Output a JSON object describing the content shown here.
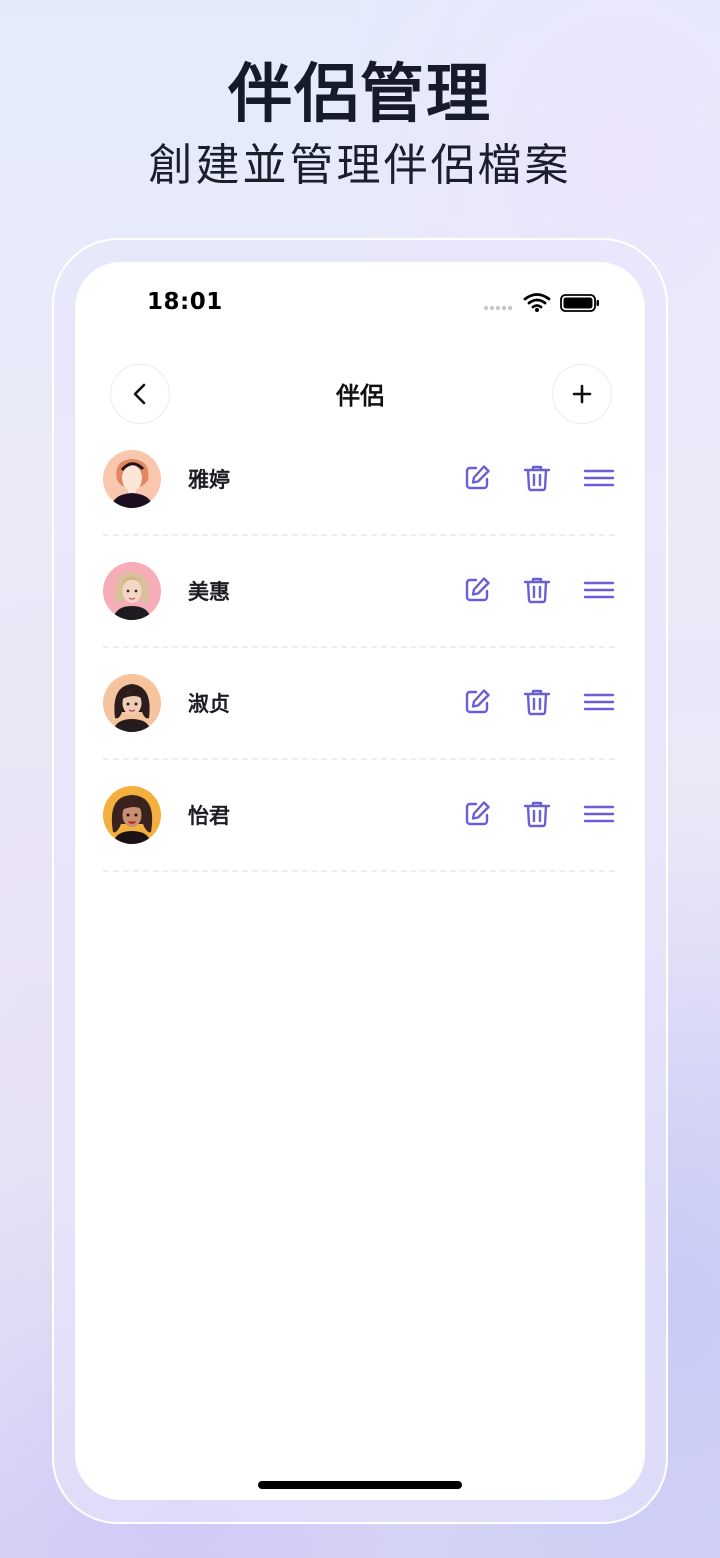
{
  "header": {
    "title": "伴侶管理",
    "subtitle": "創建並管理伴侶檔案"
  },
  "status_bar": {
    "time": "18:01"
  },
  "nav": {
    "title": "伴侶",
    "back_icon": "chevron-left-icon",
    "add_icon": "plus-icon"
  },
  "partners": [
    {
      "name": "雅婷",
      "avatar_bg": "#f9c6ae"
    },
    {
      "name": "美惠",
      "avatar_bg": "#f5aeb8"
    },
    {
      "name": "淑贞",
      "avatar_bg": "#f6c49c"
    },
    {
      "name": "怡君",
      "avatar_bg": "#f4b03e"
    }
  ],
  "row_actions": {
    "edit_icon": "edit-icon",
    "delete_icon": "trash-icon",
    "reorder_icon": "drag-handle-icon"
  },
  "colors": {
    "accent": "#6b5fd6",
    "title_text": "#161b2a",
    "divider": "#eeeeef"
  }
}
